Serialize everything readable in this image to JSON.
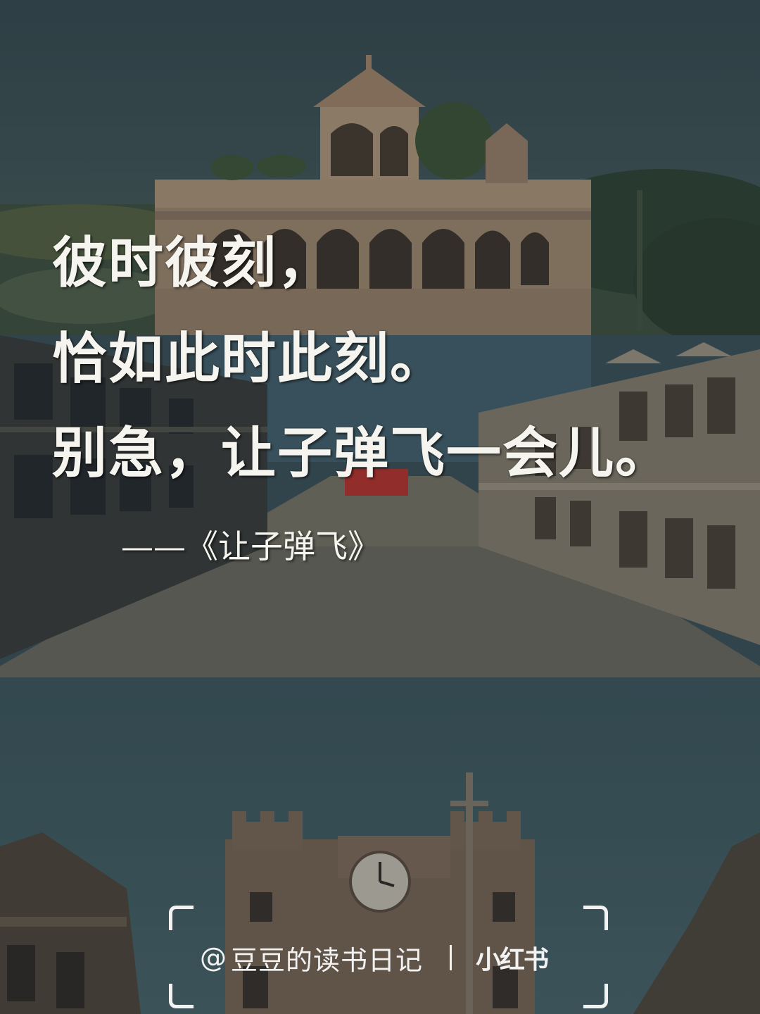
{
  "quote": {
    "line1": "彼时彼刻，",
    "line2": "恰如此时此刻。",
    "line3": "别急，让子弹飞一会儿。",
    "attribution": "——《让子弹飞》"
  },
  "watermark": {
    "at_symbol": "@",
    "author": "豆豆的读书日记",
    "brand": "小红书"
  },
  "colors": {
    "text": "#f6f4ef",
    "sky": "#3e5257",
    "shop_sign": "#c0302a"
  }
}
